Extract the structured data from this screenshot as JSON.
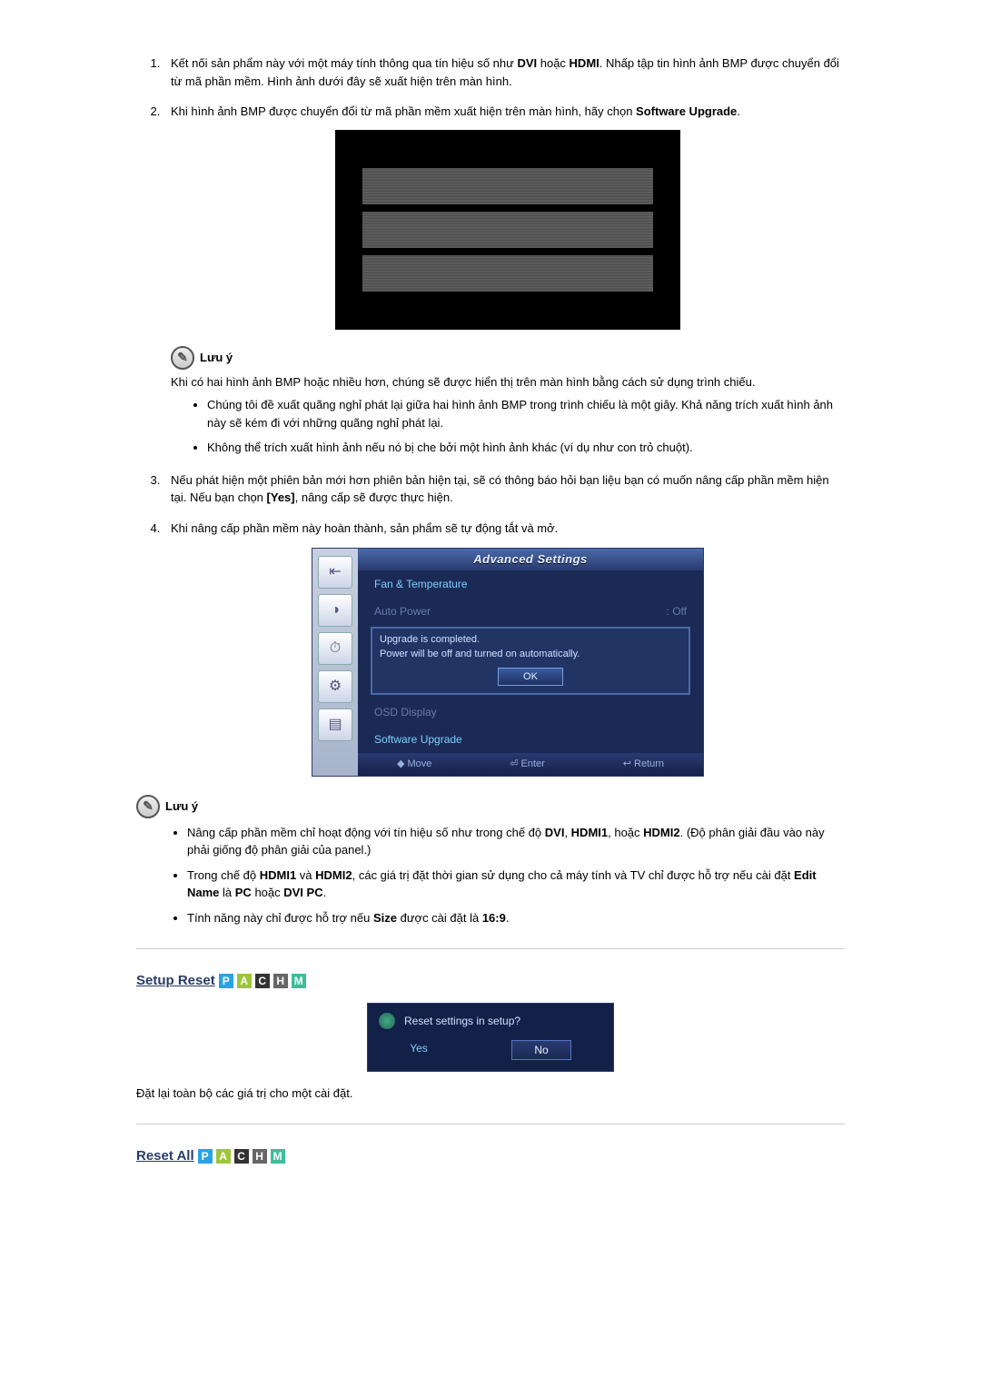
{
  "steps": {
    "s1a": "Kết nối sản phẩm này với một máy tính thông qua tín hiệu số như ",
    "s1b": " hoặc ",
    "s1c": ". Nhấp tập tin hình ảnh BMP được chuyển đổi từ mã phần mềm. Hình ảnh dưới đây sẽ xuất hiện trên màn hình.",
    "dvi": "DVI",
    "hdmi": "HDMI",
    "s2a": "Khi hình ảnh BMP được chuyển đổi từ mã phần mềm xuất hiện trên màn hình, hãy chọn ",
    "s2b": ".",
    "sw_upgrade": "Software Upgrade",
    "s3a": "Nếu phát hiện một phiên bản mới hơn phiên bản hiện tại, sẽ có thông báo hỏi bạn liệu bạn có muốn nâng cấp phần mềm hiện tại. Nếu bạn chọn ",
    "yes": "[Yes]",
    "s3b": ", nâng cấp sẽ được thực hiện.",
    "s4": "Khi nâng cấp phần mềm này hoàn thành, sản phẩm sẽ tự động tắt và mở."
  },
  "note_label": "Lưu ý",
  "note1": {
    "intro": "Khi có hai hình ảnh BMP hoặc nhiều hơn, chúng sẽ được hiển thị trên màn hình bằng cách sử dụng trình chiếu.",
    "b1": "Chúng tôi đề xuất quãng nghỉ phát lại giữa hai hình ảnh BMP trong trình chiếu là một giây. Khả năng trích xuất hình ảnh này sẽ kém đi với những quãng nghỉ phát lại.",
    "b2": "Không thể trích xuất hình ảnh nếu nó bị che bởi một hình ảnh khác (ví dụ như con trỏ chuột)."
  },
  "osd": {
    "title": "Advanced Settings",
    "fan": "Fan & Temperature",
    "auto_power": "Auto Power",
    "off": ": Off",
    "dlg1": "Upgrade is completed.",
    "dlg2": "Power will be off and turned on automatically.",
    "ok": "OK",
    "osd_display": "OSD Display",
    "sw_upgrade": "Software Upgrade",
    "move": "Move",
    "enter": "Enter",
    "return": "Return"
  },
  "note2": {
    "b1a": "Nâng cấp phần mềm chỉ hoạt động với tín hiệu số như trong chế độ ",
    "b1b": ", ",
    "b1c": ", hoặc ",
    "b1d": ". (Độ phân giải đầu vào này phải giống độ phân giải của panel.)",
    "dvi": "DVI",
    "hdmi1": "HDMI1",
    "hdmi2": "HDMI2",
    "b2a": "Trong chế độ ",
    "b2b": " và ",
    "b2c": ", các giá trị đặt thời gian sử dụng cho cả máy tính và TV chỉ được hỗ trợ nếu cài đặt ",
    "b2d": " là ",
    "b2e": " hoặc ",
    "b2f": ".",
    "edit_name": "Edit Name",
    "pc": "PC",
    "dvi_pc": "DVI PC",
    "b3a": "Tính năng này chỉ được hỗ trợ nếu ",
    "b3b": " được cài đặt là ",
    "b3c": ".",
    "size": "Size",
    "r169": "16:9"
  },
  "sections": {
    "setup_reset": "Setup Reset",
    "reset_all": "Reset All"
  },
  "tags": {
    "p": "P",
    "a": "A",
    "c": "C",
    "h": "H",
    "m": "M"
  },
  "reset_dialog": {
    "q": "Reset settings in setup?",
    "yes": "Yes",
    "no": "No"
  },
  "reset_desc": "Đặt lại toàn bộ các giá trị cho một cài đặt."
}
